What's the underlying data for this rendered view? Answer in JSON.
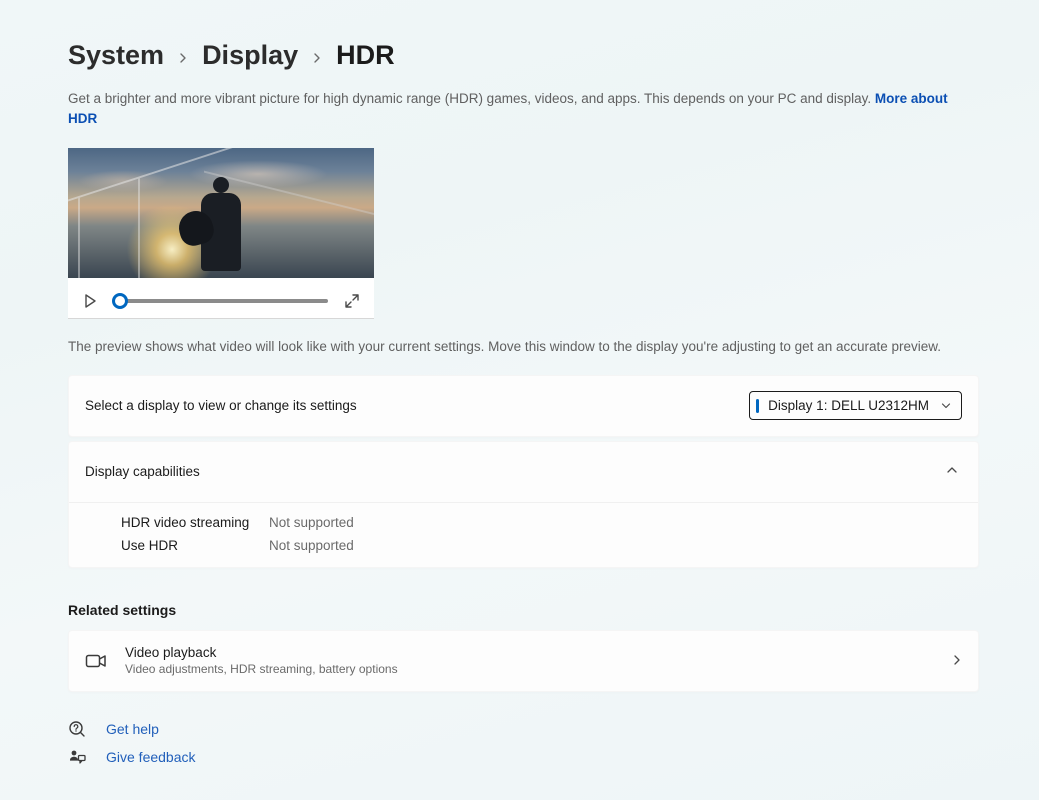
{
  "breadcrumb": {
    "level1": "System",
    "level2": "Display",
    "current": "HDR"
  },
  "description": {
    "text": "Get a brighter and more vibrant picture for high dynamic range (HDR) games, videos, and apps. This depends on your PC and display. ",
    "link": "More about HDR"
  },
  "preview": {
    "caption": "The preview shows what video will look like with your current settings. Move this window to the display you're adjusting to get an accurate preview."
  },
  "displaySelector": {
    "label": "Select a display to view or change its settings",
    "selected": "Display 1: DELL U2312HM"
  },
  "capabilities": {
    "header": "Display capabilities",
    "rows": [
      {
        "key": "HDR video streaming",
        "value": "Not supported"
      },
      {
        "key": "Use HDR",
        "value": "Not supported"
      }
    ]
  },
  "relatedSettings": {
    "header": "Related settings",
    "items": [
      {
        "title": "Video playback",
        "subtitle": "Video adjustments, HDR streaming, battery options"
      }
    ]
  },
  "footer": {
    "help": "Get help",
    "feedback": "Give feedback"
  }
}
